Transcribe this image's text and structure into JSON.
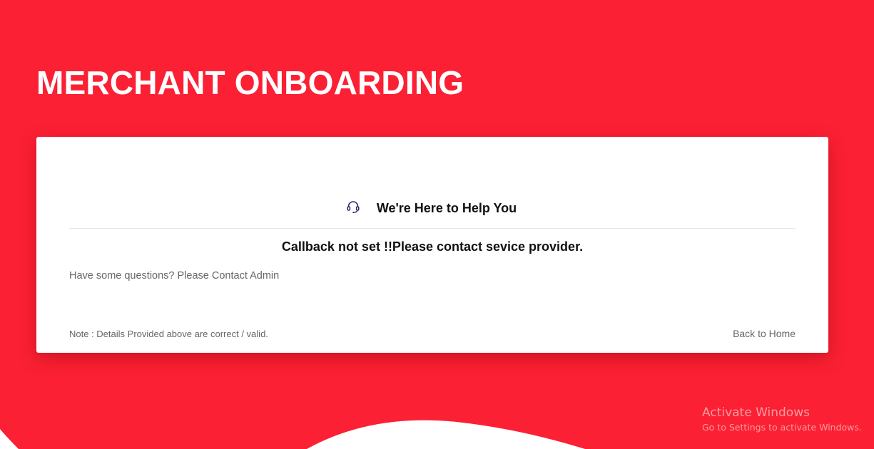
{
  "page": {
    "title": "MERCHANT ONBOARDING",
    "background_color": "#fb2033"
  },
  "card": {
    "help_icon": "headset-icon",
    "help_title": "We're Here to Help You",
    "message": "Callback not set !!Please contact sevice provider.",
    "questions_text": "Have some questions? Please Contact Admin",
    "note_text": "Note : Details Provided above are correct / valid.",
    "back_home_label": "Back to Home"
  },
  "watermark": {
    "title": "Activate Windows",
    "subtitle": "Go to Settings to activate Windows."
  },
  "colors": {
    "accent": "#fb2033",
    "icon": "#3b1f6e",
    "text_dark": "#111111",
    "text_muted": "#666666"
  }
}
